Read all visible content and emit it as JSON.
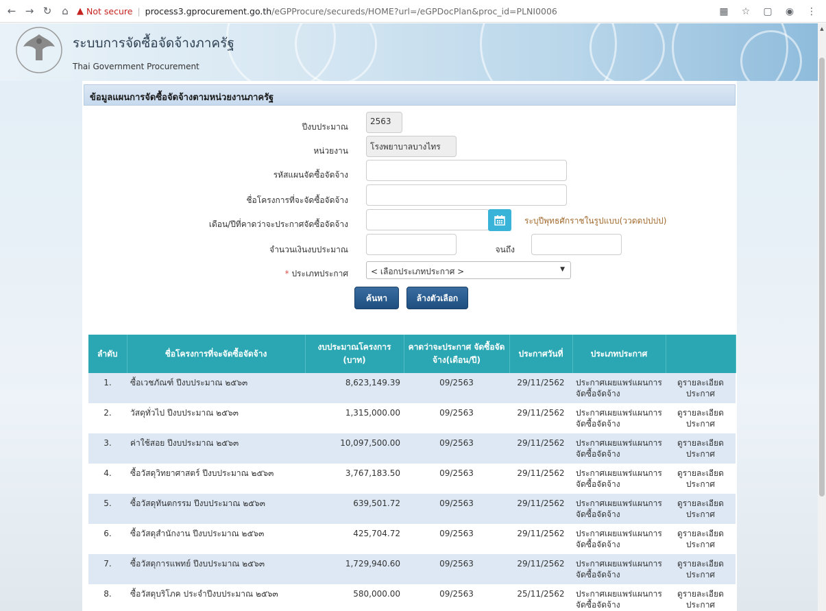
{
  "browser": {
    "not_secure": "Not secure",
    "url_host": "process3.gprocurement.go.th",
    "url_path": "/eGPProcure/secureds/HOME?url=/eGPDocPlan&proc_id=PLNI0006"
  },
  "header": {
    "title_th": "ระบบการจัดซื้อจัดจ้างภาครัฐ",
    "title_en": "Thai Government Procurement"
  },
  "section": {
    "title": "ข้อมูลแผนการจัดซื้อจัดจ้างตามหน่วยงานภาครัฐ"
  },
  "form": {
    "fiscal_year_label": "ปีงบประมาณ",
    "fiscal_year_value": "2563",
    "agency_label": "หน่วยงาน",
    "agency_value": "โรงพยาบาลบางไทร",
    "plan_code_label": "รหัสแผนจัดซื้อจัดจ้าง",
    "plan_code_value": "",
    "project_name_label": "ชื่อโครงการที่จะจัดซื้อจัดจ้าง",
    "project_name_value": "",
    "announce_month_label": "เดือน/ปีที่คาดว่าจะประกาศจัดซื้อจัดจ้าง",
    "announce_month_value": "",
    "date_hint": "ระบุปีพุทธศักราชในรูปแบบ(ววดดปปปป)",
    "budget_label": "จำนวนเงินงบประมาณ",
    "budget_from_value": "",
    "budget_to_label": "จนถึง",
    "budget_to_value": "",
    "required_mark": "*",
    "announce_type_label": "ประเภทประกาศ",
    "announce_type_selected": "< เลือกประเภทประกาศ >",
    "search_button": "ค้นหา",
    "clear_button": "ล้างตัวเลือก"
  },
  "table": {
    "headers": [
      "ลำดับ",
      "ชื่อโครงการที่จะจัดซื้อจัดจ้าง",
      "งบประมาณโครงการ (บาท)",
      "คาดว่าจะประกาศ จัดซื้อจัดจ้าง(เดือน/ปี)",
      "ประกาศวันที่",
      "ประเภทประกาศ",
      ""
    ],
    "rows": [
      {
        "no": "1.",
        "name": "ซื้อเวชภัณฑ์ ปีงบประมาณ ๒๕๖๓",
        "budget": "8,623,149.39",
        "expected": "09/2563",
        "date": "29/11/2562",
        "type": "ประกาศเผยแพร่แผนการจัดซื้อจัดจ้าง",
        "link": "ดูรายละเอียดประกาศ"
      },
      {
        "no": "2.",
        "name": "วัสดุทั่วไป ปีงบประมาณ ๒๕๖๓",
        "budget": "1,315,000.00",
        "expected": "09/2563",
        "date": "29/11/2562",
        "type": "ประกาศเผยแพร่แผนการจัดซื้อจัดจ้าง",
        "link": "ดูรายละเอียดประกาศ"
      },
      {
        "no": "3.",
        "name": "ค่าใช้สอย ปีงบประมาณ ๒๕๖๓",
        "budget": "10,097,500.00",
        "expected": "09/2563",
        "date": "29/11/2562",
        "type": "ประกาศเผยแพร่แผนการจัดซื้อจัดจ้าง",
        "link": "ดูรายละเอียดประกาศ"
      },
      {
        "no": "4.",
        "name": "ซื้อวัสดุวิทยาศาสตร์ ปีงบประมาณ ๒๕๖๓",
        "budget": "3,767,183.50",
        "expected": "09/2563",
        "date": "29/11/2562",
        "type": "ประกาศเผยแพร่แผนการจัดซื้อจัดจ้าง",
        "link": "ดูรายละเอียดประกาศ"
      },
      {
        "no": "5.",
        "name": "ซื้อวัสดุทันตกรรม ปีงบประมาณ ๒๕๖๓",
        "budget": "639,501.72",
        "expected": "09/2563",
        "date": "29/11/2562",
        "type": "ประกาศเผยแพร่แผนการจัดซื้อจัดจ้าง",
        "link": "ดูรายละเอียดประกาศ"
      },
      {
        "no": "6.",
        "name": "ซื้อวัสดุสำนักงาน ปีงบประมาณ ๒๕๖๓",
        "budget": "425,704.72",
        "expected": "09/2563",
        "date": "29/11/2562",
        "type": "ประกาศเผยแพร่แผนการจัดซื้อจัดจ้าง",
        "link": "ดูรายละเอียดประกาศ"
      },
      {
        "no": "7.",
        "name": "ซื้อวัสดุการแพทย์ ปีงบประมาณ ๒๕๖๓",
        "budget": "1,729,940.60",
        "expected": "09/2563",
        "date": "29/11/2562",
        "type": "ประกาศเผยแพร่แผนการจัดซื้อจัดจ้าง",
        "link": "ดูรายละเอียดประกาศ"
      },
      {
        "no": "8.",
        "name": "ซื้อวัสดุบริโภค ประจำปีงบประมาณ ๒๕๖๓",
        "budget": "580,000.00",
        "expected": "09/2563",
        "date": "25/11/2562",
        "type": "ประกาศเผยแพร่แผนการจัดซื้อจัดจ้าง",
        "link": "ดูรายละเอียดประกาศ"
      }
    ]
  },
  "colors": {
    "table_header": "#2aa7b3",
    "row_alt": "#dde8f4",
    "button": "#2a5d91",
    "link": "#2f6aa8",
    "hint": "#a26a2e"
  }
}
